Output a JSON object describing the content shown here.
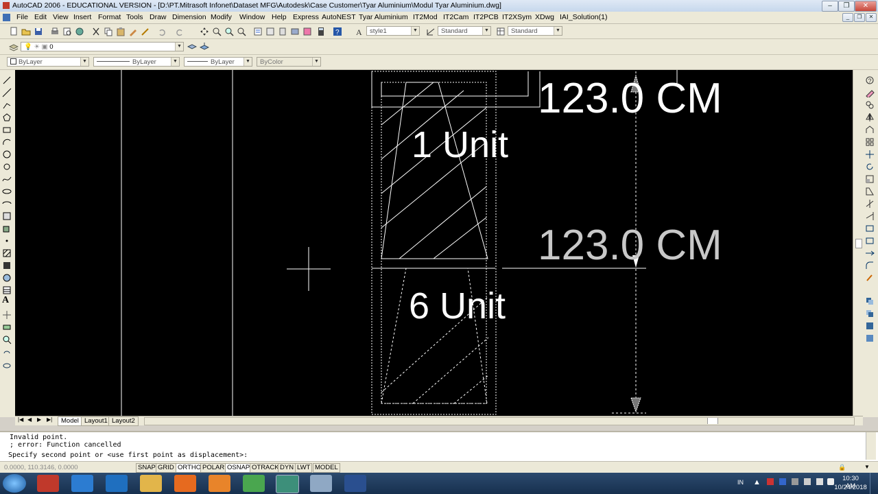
{
  "window": {
    "title": "AutoCAD 2006 - EDUCATIONAL VERSION - [D:\\PT.Mitrasoft Infonet\\Dataset MFG\\Autodesk\\Case Customer\\Tyar Aluminium\\Modul Tyar Aluminium.dwg]",
    "minimize": "–",
    "restore": "❐",
    "close": "✕"
  },
  "menu": [
    "File",
    "Edit",
    "View",
    "Insert",
    "Format",
    "Tools",
    "Draw",
    "Dimension",
    "Modify",
    "Window",
    "Help",
    "Express",
    "AutoNEST",
    "Tyar Aluminium",
    "IT2Mod",
    "IT2Cam",
    "IT2PCB",
    "IT2XSym",
    "XDwg",
    "IAI_Solution(1)"
  ],
  "styles": {
    "text_style": "style1",
    "dim_style": "Standard",
    "table_style": "Standard"
  },
  "layers": {
    "current_layer": "0"
  },
  "properties": {
    "color": "ByLayer",
    "linetype": "ByLayer",
    "lineweight": "ByLayer",
    "plotstyle": "ByColor"
  },
  "drawing": {
    "label_top_dim": "123.0 CM",
    "label_mid_dim": "123.0 CM",
    "label_unit1": "1 Unit",
    "label_unit6": "6 Unit"
  },
  "tabs": [
    "Model",
    "Layout1",
    "Layout2"
  ],
  "command": {
    "line1": "Invalid point.",
    "line2": "; error: Function cancelled",
    "prompt": "Specify second point or <use first point as displacement>:"
  },
  "status": {
    "coords": "0.0000, 110.3146, 0.0000",
    "toggles": [
      "SNAP",
      "GRID",
      "ORTHO",
      "POLAR",
      "OSNAP",
      "OTRACK",
      "DYN",
      "LWT",
      "MODEL"
    ]
  },
  "taskbar": {
    "lang": "IN",
    "time": "10:30 AM",
    "date": "10/24/2018"
  },
  "colors": {
    "accent": "#316ac5",
    "canvas": "#000000",
    "chrome": "#ece9d8"
  }
}
